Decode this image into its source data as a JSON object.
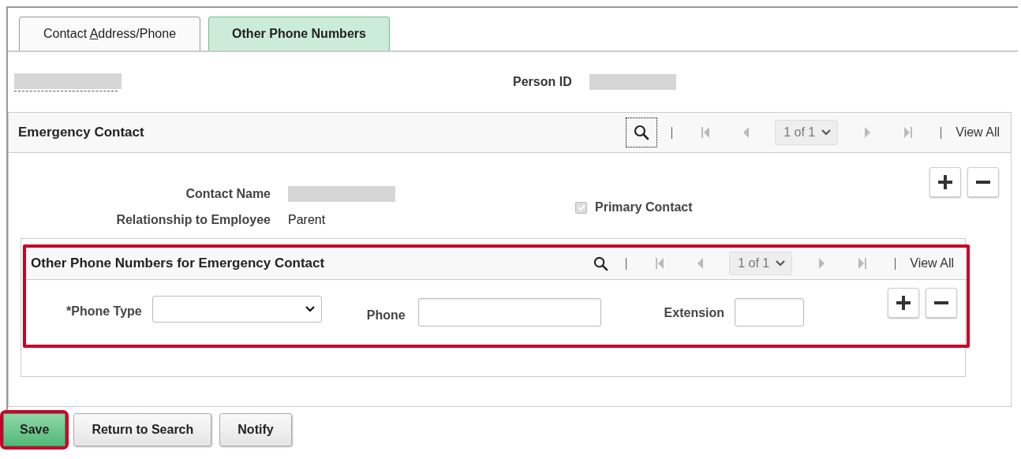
{
  "tabs": [
    {
      "label_parts": [
        {
          "text": "Contact ",
          "underlined": false
        },
        {
          "text": "A",
          "underlined": true
        },
        {
          "text": "ddress/Phone",
          "underlined": false
        }
      ],
      "selected": false
    },
    {
      "label": "Other Phone Numbers",
      "selected": true
    }
  ],
  "header": {
    "name_redacted": true,
    "person_id_label": "Person ID",
    "person_id_redacted": true
  },
  "emergency_contact": {
    "title": "Emergency Contact",
    "pager": {
      "search_focused": true,
      "page": "1 of 1",
      "view_all": "View All"
    },
    "fields": [
      {
        "label": "Contact Name",
        "redacted": true
      },
      {
        "label": "Relationship to Employee",
        "value": "Parent"
      }
    ],
    "primary_contact": {
      "label": "Primary Contact",
      "checked": true,
      "disabled": true
    },
    "other_phones": {
      "title": "Other Phone Numbers for Emergency Contact",
      "highlighted": true,
      "pager": {
        "search_focused": false,
        "page": "1 of 1",
        "view_all": "View All"
      },
      "fields": [
        {
          "kind": "select",
          "label": "*Phone Type"
        },
        {
          "kind": "text",
          "label": "Phone"
        },
        {
          "kind": "text",
          "label": "Extension"
        }
      ]
    }
  },
  "buttons": [
    {
      "label": "Save",
      "primary": true,
      "highlighted": true
    },
    {
      "label": "Return to Search",
      "primary": false,
      "highlighted": false
    },
    {
      "label": "Notify",
      "primary": false,
      "highlighted": false
    }
  ]
}
